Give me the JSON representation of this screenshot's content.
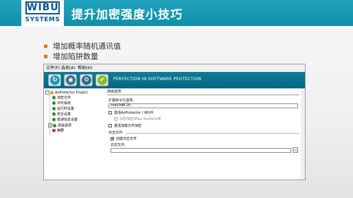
{
  "slide": {
    "logo_top": "WIBU",
    "logo_bottom": "SYSTEMS",
    "title": "提升加密强度小技巧",
    "bullets": [
      "增加概率随机通讯值",
      "增加陷阱数量"
    ]
  },
  "app": {
    "menu": [
      "文件(F)",
      "选项(A)",
      "帮助(H)"
    ],
    "toolbar_icons": [
      "reload-icon",
      "settings-icon",
      "gear-icon",
      "check-icon"
    ],
    "banner_text": "PERFECTION IN SOFTWARE PROTECTION",
    "tree": {
      "root": "AxProtector Project",
      "items": [
        "加密文件",
        "许可系统",
        "运行时设置",
        "安全设置",
        "错误信息设置",
        "高级选项",
        "摘要"
      ],
      "icon_colors": [
        "#2d8a2d",
        "#2d8a2d",
        "#2d8a2d",
        "#2d8a2d",
        "#2d8a2d",
        "#2d8a2d",
        "#c0392b"
      ]
    },
    "content": {
      "section_title": "高级选项:",
      "ext_cmd_label": "扩展命令行选项:",
      "ext_cmd_value": "-rsd2048,20",
      "check1_label": "激活AxProtector / WUPI",
      "check2_label": "动态加密Wibu-Systems库",
      "check3_label": "激活加载文件加密",
      "log_group_label": "日志文件:",
      "create_log_label": "创建日志文件",
      "create_log_checked": "✔",
      "log_file_label": "日志文件:",
      "log_file_value": "",
      "browse_label": "..."
    }
  }
}
